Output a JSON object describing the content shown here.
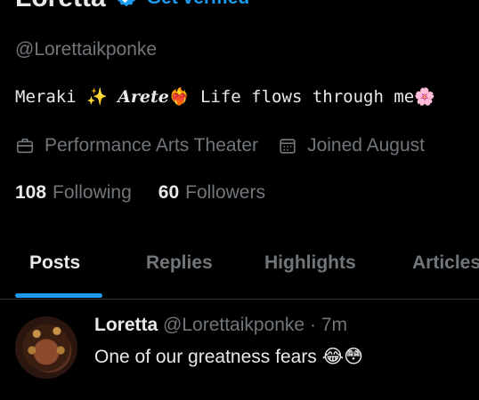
{
  "profile": {
    "display_name": "Loretta",
    "verified_icon": "verified-badge-icon",
    "get_verified_label": "Get verified",
    "handle": "@Lorettaikponke",
    "bio": {
      "part1": "Meraki ✨ ",
      "script_name": "Arete",
      "part2": "❤️‍🔥 Life flows through me🌸"
    },
    "meta": {
      "work_icon": "briefcase-icon",
      "work": "Performance Arts Theater",
      "joined_icon": "calendar-icon",
      "joined": "Joined August"
    },
    "stats": {
      "following_count": "108",
      "following_label": "Following",
      "followers_count": "60",
      "followers_label": "Followers"
    }
  },
  "tabs": [
    {
      "label": "Posts",
      "active": true
    },
    {
      "label": "Replies",
      "active": false
    },
    {
      "label": "Highlights",
      "active": false
    },
    {
      "label": "Articles",
      "active": false
    }
  ],
  "post": {
    "author": "Loretta",
    "handle": "@Lorettaikponke",
    "separator": "·",
    "time": "7m",
    "text": "One of our greatness fears 😂😳"
  },
  "colors": {
    "background": "#000000",
    "primary_text": "#e7e9ea",
    "secondary_text": "#71767b",
    "accent": "#1d9bf0",
    "divider": "#2f3336"
  }
}
